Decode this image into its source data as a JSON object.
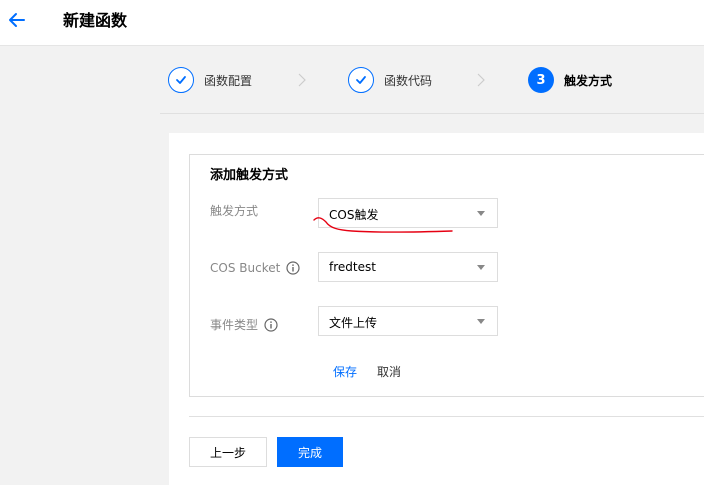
{
  "header": {
    "title": "新建函数",
    "back_icon": "arrow-left-icon"
  },
  "steps": [
    {
      "label": "函数配置",
      "status": "done"
    },
    {
      "label": "函数代码",
      "status": "done"
    },
    {
      "number": "3",
      "label": "触发方式",
      "status": "active"
    }
  ],
  "trigger": {
    "section_title": "添加触发方式",
    "fields": {
      "trigger_type": {
        "label": "触发方式",
        "value": "COS触发"
      },
      "cos_bucket": {
        "label": "COS Bucket",
        "value": "fredtest"
      },
      "event_type": {
        "label": "事件类型",
        "value": "文件上传"
      }
    },
    "save_label": "保存",
    "cancel_label": "取消"
  },
  "footer": {
    "prev_label": "上一步",
    "finish_label": "完成"
  },
  "colors": {
    "accent": "#006eff",
    "annotation": "#e60012"
  }
}
